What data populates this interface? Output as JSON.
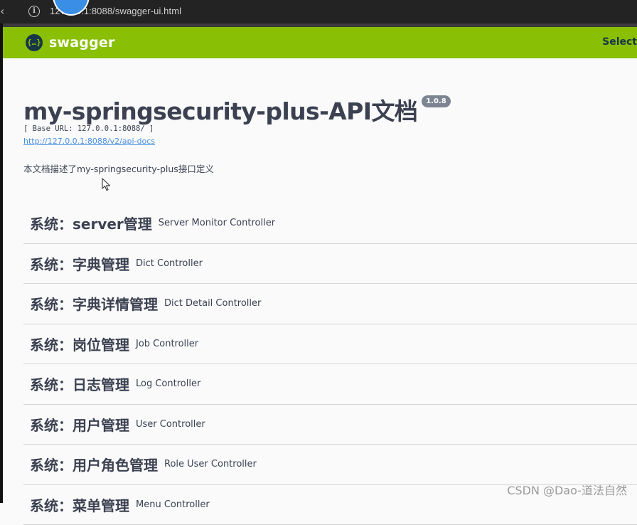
{
  "browser": {
    "url": "127.0.0.1:8088/swagger-ui.html",
    "back_glyph": "‹",
    "info_glyph": "i"
  },
  "topbar": {
    "logo_glyph": "{…}",
    "logo_text": "swagger",
    "select_label": "Select"
  },
  "info": {
    "title": "my-springsecurity-plus-API文档",
    "version": "1.0.8",
    "base_url": "[ Base URL: 127.0.0.1:8088/ ]",
    "api_docs_link": "http://127.0.0.1:8088/v2/api-docs",
    "description": "本文档描述了my-springsecurity-plus接口定义"
  },
  "tags": [
    {
      "name": "系统：server管理",
      "controller": "Server Monitor Controller"
    },
    {
      "name": "系统：字典管理",
      "controller": "Dict Controller"
    },
    {
      "name": "系统：字典详情管理",
      "controller": "Dict Detail Controller"
    },
    {
      "name": "系统：岗位管理",
      "controller": "Job Controller"
    },
    {
      "name": "系统：日志管理",
      "controller": "Log Controller"
    },
    {
      "name": "系统：用户管理",
      "controller": "User Controller"
    },
    {
      "name": "系统：用户角色管理",
      "controller": "Role User Controller"
    },
    {
      "name": "系统：菜单管理",
      "controller": "Menu Controller"
    }
  ],
  "watermark": "CSDN @Dao-道法自然",
  "colors": {
    "topbar": "#89bf04",
    "text": "#3b4151",
    "link": "#4990e2",
    "version_badge": "#7d8492"
  }
}
